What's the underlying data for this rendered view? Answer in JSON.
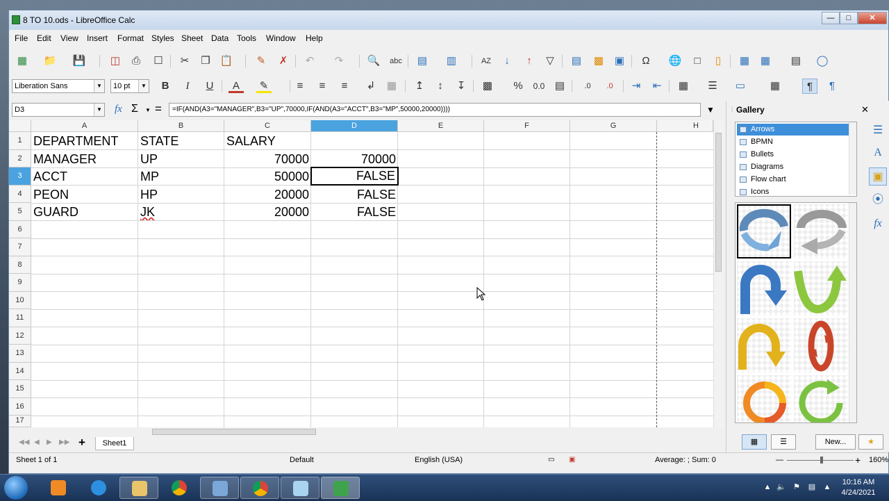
{
  "window": {
    "title": "8 TO 10.ods - LibreOffice Calc"
  },
  "menu": [
    "File",
    "Edit",
    "View",
    "Insert",
    "Format",
    "Styles",
    "Sheet",
    "Data",
    "Tools",
    "Window",
    "Help"
  ],
  "format_toolbar": {
    "font_name": "Liberation Sans",
    "font_size": "10 pt",
    "bold": "B",
    "italic": "I",
    "underline": "U",
    "percent": "%",
    "decimal": "0.0"
  },
  "formula_bar": {
    "name_box": "D3",
    "fx": "fx",
    "sigma": "Σ",
    "equals": "=",
    "formula": "=IF(AND(A3=\"MANAGER\",B3=\"UP\",70000,IF(AND(A3=\"ACCT\",B3=\"MP\",50000,20000))))"
  },
  "sheet": {
    "columns": [
      "A",
      "B",
      "C",
      "D",
      "E",
      "F",
      "G",
      "H"
    ],
    "rows": [
      "1",
      "2",
      "3",
      "4",
      "5",
      "6",
      "7",
      "8",
      "9",
      "10",
      "11",
      "12",
      "13",
      "14",
      "15",
      "16",
      "17"
    ],
    "selected_column": "D",
    "selected_row": "3",
    "cells": {
      "A1": "DEPARTMENT",
      "B1": "STATE",
      "C1": "SALARY",
      "A2": "MANAGER",
      "B2": "UP",
      "C2": "70000",
      "D2": "70000",
      "A3": "ACCT",
      "B3": "MP",
      "C3": "50000",
      "D3": "FALSE",
      "A4": "PEON",
      "B4": "HP",
      "C4": "20000",
      "D4": "FALSE",
      "A5": "GUARD",
      "B5": "JK",
      "C5": "20000",
      "D5": "FALSE"
    }
  },
  "tabs": {
    "add": "+",
    "sheet1": "Sheet1"
  },
  "status": {
    "sheet_pos": "Sheet 1 of 1",
    "page_style": "Default",
    "language": "English (USA)",
    "summary": "Average: ; Sum: 0",
    "zoom": "160%"
  },
  "gallery": {
    "title": "Gallery",
    "themes": [
      "Arrows",
      "BPMN",
      "Bullets",
      "Diagrams",
      "Flow chart",
      "Icons"
    ],
    "selected_theme": "Arrows",
    "new_button": "New..."
  },
  "taskbar": {
    "time": "10:16 AM",
    "date": "4/24/2021"
  },
  "colors": {
    "accent": "#4aa3df",
    "selection": "#3d8fd9"
  }
}
